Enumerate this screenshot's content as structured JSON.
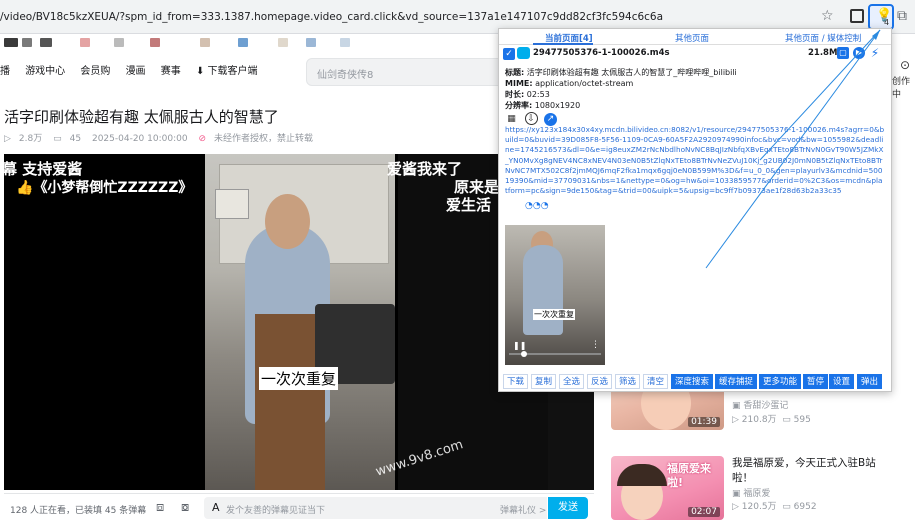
{
  "browser": {
    "url": "/video/BV18c5kzXEUA/?spm_id_from=333.1387.homepage.video_card.click&vd_source=137a1e147107c9dd82cf3fc594c6c6a",
    "ext_badge": "4",
    "star_icon": "star-icon",
    "puzzle_icon": "puzzle-icon"
  },
  "nav": {
    "items": [
      "播",
      "游戏中心",
      "会员购",
      "漫画",
      "赛事",
      "下载客户端"
    ],
    "search_placeholder": "仙剑奇侠传8",
    "right_label": "创作中"
  },
  "video": {
    "title": "活字印刷体验超有趣 太佩服古人的智慧了",
    "views": "2.8万",
    "danmaku_count": "45",
    "date": "2025-04-20 10:00:00",
    "copyright": "未经作者授权，禁止转载",
    "overlay": {
      "left1": "幕 支持爱酱",
      "left2": "《小梦帮倒忙ZZZZZZ》",
      "right1": "爱酱我来了",
      "right2": "原来是",
      "right3": "爱生活",
      "subtitle": "一次次重复",
      "watermark": "www.9v8.com"
    }
  },
  "danmu_bar": {
    "status": "128 人正在看，已装填 45 条弹幕",
    "input_placeholder": "发个友善的弹幕见证当下",
    "etiquette": "弹幕礼仪 >",
    "send": "发送"
  },
  "recommendations": [
    {
      "title": "",
      "uploader": "香甜沙蛋记",
      "views": "210.8万",
      "comments": "595",
      "duration": "01:39"
    },
    {
      "title": "我是福原爱，今天正式入驻B站啦！",
      "uploader": "福原爱",
      "views": "120.5万",
      "comments": "6952",
      "duration": "02:07",
      "thumb_caption": "福原爱来啦!"
    }
  ],
  "popup": {
    "tabs": [
      "当前页面[4]",
      "其他页面",
      "其他页面 / 媒体控制"
    ],
    "filename": "29477505376-1-100026.m4s",
    "size": "21.8MB",
    "title_label": "标题:",
    "title_value": "活字印刷体验超有趣 太佩服古人的智慧了_哔哩哔哩_bilibili",
    "mime_label": "MIME:",
    "mime_value": "application/octet-stream",
    "duration_label": "时长:",
    "duration_value": "02:53",
    "resolution_label": "分辨率:",
    "resolution_value": "1080x1920",
    "link": "https://xy123x184x30x4xy.mcdn.bilivideo.cn:8082/v1/resource/29477505376-1-100026.m4s?agrr=0&build=0&buvid=39D085F8-5F56-1109-0CA9-60A5F2A2920974990infoc&bvc=vod&bw=1055982&deadline=1745216573&dl=0&e=ig8euxZM2rNcNbdlhoNvNC8BqJIzNbfqXBvEqxTEto8BTrNvN0GvT90W5JZMkX_YN0MvXg8gNEV4NC8xNEV4N03eN0B5tZlqNxTEto8BTrNvNeZVuJ10Kj_g2UB02J0mN0B5tZlqNxTEto8BTrNvNC7MTX502C8f2jmMQJ6mqF2fka1mqx6gqj0eN0B599M%3D&f=u_0_0&gen=playurlv3&mcdnid=50019390&mid=37709031&nbs=1&nettype=0&og=hw&oi=1033859577&orderid=0%2C3&os=mcdn&platform=pc&sign=9de150&tag=&trid=00&uipk=5&upsig=bc9ff7b09373ae1f28d63b2a33c35",
    "buttons": [
      "下载",
      "复制",
      "全选",
      "反选",
      "筛选",
      "清空",
      "深度搜索",
      "缓存捕捉",
      "更多功能",
      "暂停",
      "设置",
      "弹出"
    ],
    "preview_subtitle": "一次次重复"
  },
  "colors": {
    "accent": "#1a73e8",
    "bili_blue": "#00aeec",
    "link": "#2a6fd8"
  }
}
